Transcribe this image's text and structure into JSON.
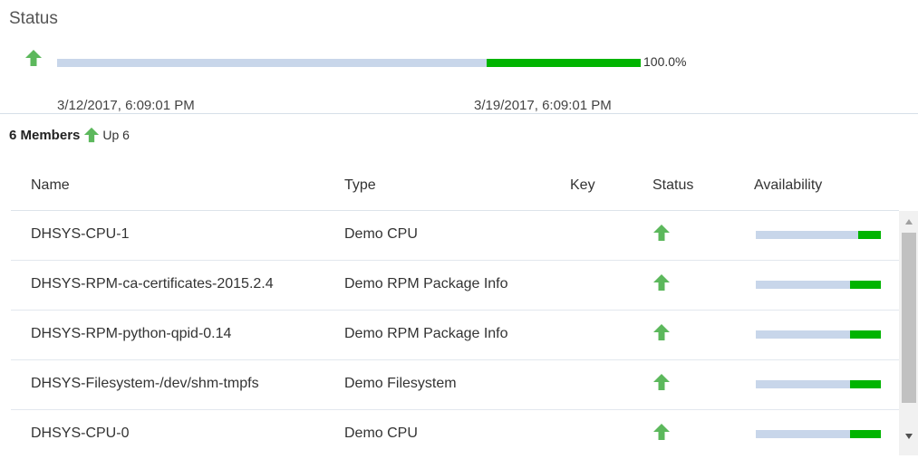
{
  "title": "Status",
  "availability": {
    "percent_label": "100.0%",
    "start_date": "3/12/2017, 6:09:01 PM",
    "end_date": "3/19/2017, 6:09:01 PM"
  },
  "members": {
    "count_label": "6 Members",
    "up_label": "Up 6"
  },
  "table": {
    "headers": {
      "name": "Name",
      "type": "Type",
      "key": "Key",
      "status": "Status",
      "availability": "Availability"
    },
    "rows": [
      {
        "name": "DHSYS-CPU-1",
        "type": "Demo CPU",
        "key": "",
        "status": "up-arrow-icon"
      },
      {
        "name": "DHSYS-RPM-ca-certificates-2015.2.4",
        "type": "Demo RPM Package Info",
        "key": "",
        "status": "up-arrow-icon"
      },
      {
        "name": "DHSYS-RPM-python-qpid-0.14",
        "type": "Demo RPM Package Info",
        "key": "",
        "status": "up-arrow-icon"
      },
      {
        "name": "DHSYS-Filesystem-/dev/shm-tmpfs",
        "type": "Demo Filesystem",
        "key": "",
        "status": "up-arrow-icon"
      },
      {
        "name": "DHSYS-CPU-0",
        "type": "Demo CPU",
        "key": "",
        "status": "up-arrow-icon"
      }
    ]
  },
  "colors": {
    "up": "#5cb85c",
    "available": "#00b400",
    "track": "#c8d6ea"
  }
}
